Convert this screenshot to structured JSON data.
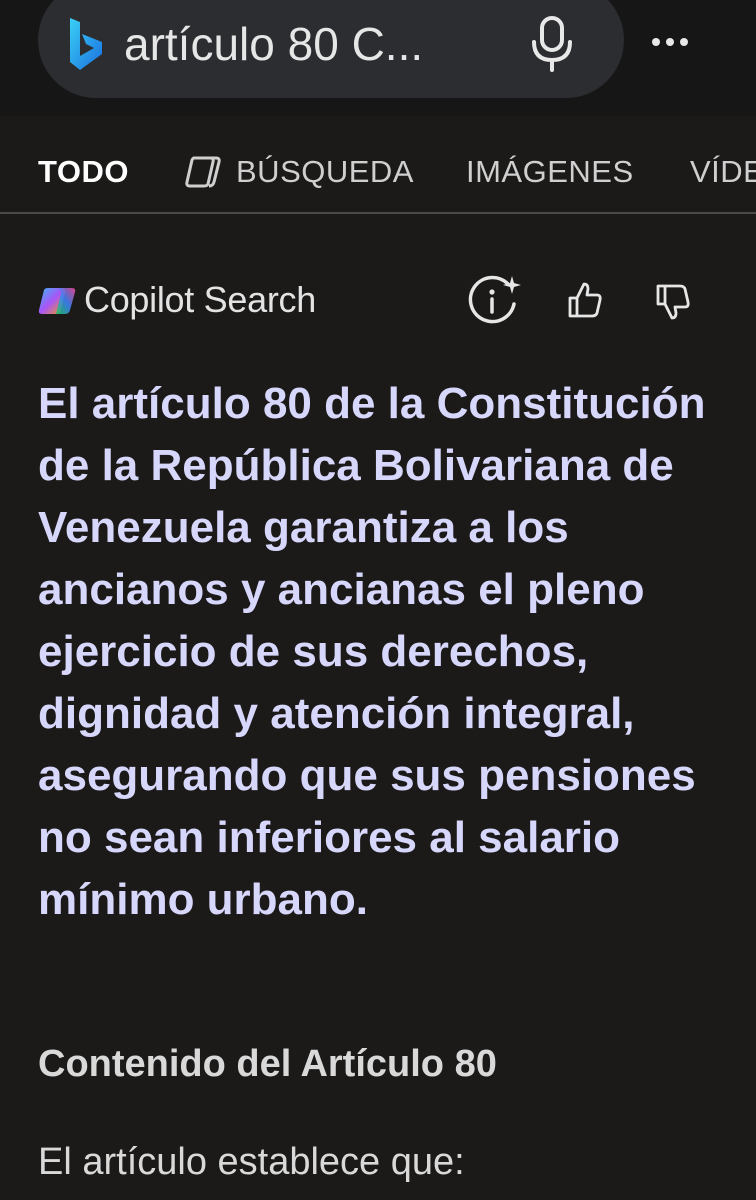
{
  "search": {
    "query": "artículo 80 C...",
    "logo_icon": "bing-logo-icon",
    "mic_icon": "microphone-icon",
    "more_icon": "more-dots-icon"
  },
  "tabs": [
    {
      "label": "TODO",
      "active": true
    },
    {
      "label": "BÚSQUEDA",
      "icon": "copilot-search-icon"
    },
    {
      "label": "IMÁGENES"
    },
    {
      "label": "VÍDE"
    }
  ],
  "copilot": {
    "title": "Copilot Search",
    "icons": [
      "info-sparkle-icon",
      "thumbs-up-icon",
      "thumbs-down-icon"
    ]
  },
  "answer": {
    "text": "El artículo 80 de la Constitución de la República Bolivariana de Venezuela garantiza a los ancianos y ancianas el pleno ejercicio de sus derechos, dignidad y atención integral, asegurando que sus pensiones no sean inferiores al salario mínimo urbano."
  },
  "section": {
    "heading": "Contenido del Artículo 80",
    "body": "El artículo establece que:"
  },
  "colors": {
    "background": "#1b1a19",
    "answer_text": "#d7d6fb",
    "bing_blue": "#2b8fe8"
  }
}
